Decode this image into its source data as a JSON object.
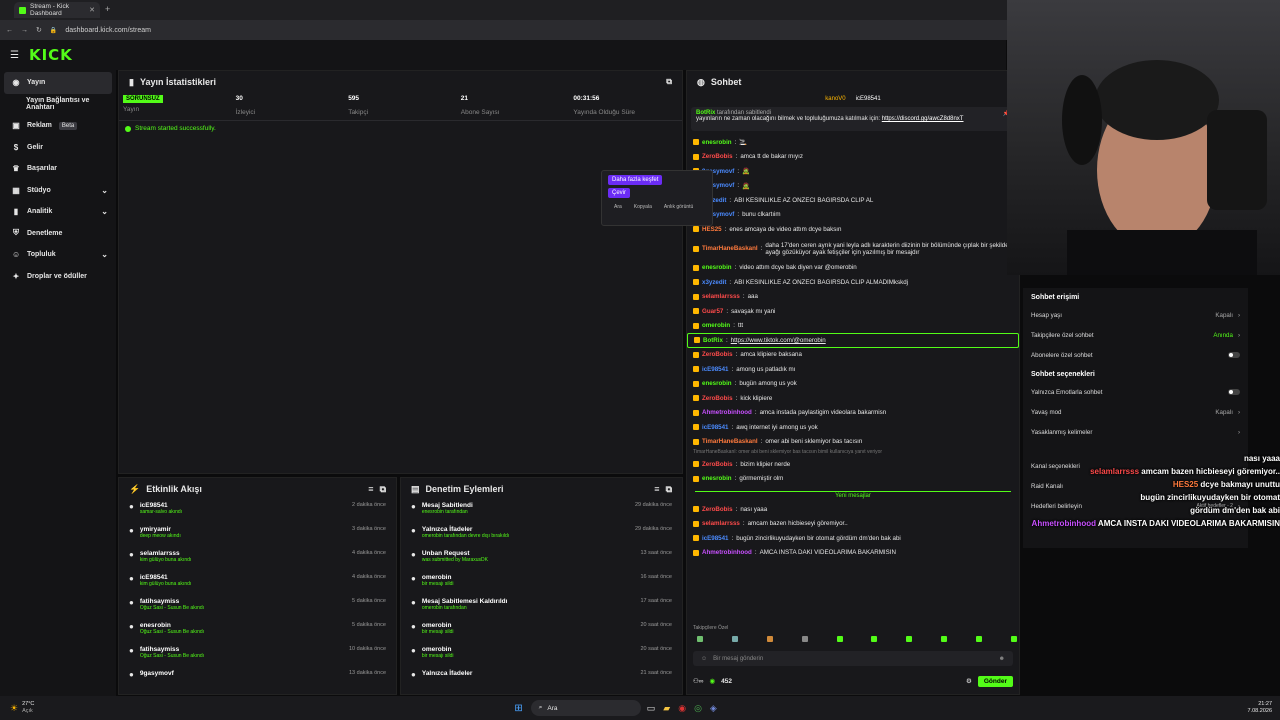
{
  "browser": {
    "tab_title": "Stream - Kick Dashboard",
    "url": "dashboard.kick.com/stream"
  },
  "brand": {
    "logo": "KICK",
    "accent": "#53fc18"
  },
  "sidebar": {
    "items": [
      {
        "label": "Yayın",
        "active": true
      },
      {
        "label": "Yayın Bağlantısı ve Anahtarı"
      },
      {
        "label": "Reklam",
        "badge": "Beta"
      },
      {
        "label": "Gelir"
      },
      {
        "label": "Başarılar"
      },
      {
        "label": "Stüdyo",
        "chevron": true
      },
      {
        "label": "Analitik",
        "chevron": true
      },
      {
        "label": "Denetleme"
      },
      {
        "label": "Topluluk",
        "chevron": true
      },
      {
        "label": "Droplar ve ödüller"
      }
    ]
  },
  "stats": {
    "title": "Yayın İstatistikleri",
    "live_badge": "SORUNSUZ",
    "items": [
      {
        "value": "",
        "label": "Yayın"
      },
      {
        "value": "30",
        "label": "İzleyici"
      },
      {
        "value": "595",
        "label": "Takipçi"
      },
      {
        "value": "21",
        "label": "Abone Sayısı"
      },
      {
        "value": "00:31:56",
        "label": "Yayında Olduğu Süre"
      }
    ],
    "success": "Stream started successfully."
  },
  "activity": {
    "title": "Etkinlik Akışı",
    "rows": [
      {
        "name": "icE98541",
        "sub": "samar-salvo akındı",
        "time": "2 dakika önce"
      },
      {
        "name": "ymiryamir",
        "sub": "deep meow akındı",
        "time": "3 dakika önce"
      },
      {
        "name": "selamlarrsss",
        "sub": "kim gülüyo buna akındı",
        "time": "4 dakika önce"
      },
      {
        "name": "icE98541",
        "sub": "kim gülüyo buna akındı",
        "time": "4 dakika önce"
      },
      {
        "name": "fatihsaymiss",
        "sub": "Oğuz Sasi - Susun Be akındı",
        "time": "5 dakika önce"
      },
      {
        "name": "enesrobin",
        "sub": "Oğuz Sasi - Susun Be akındı",
        "time": "5 dakika önce"
      },
      {
        "name": "fatihsaymiss",
        "sub": "Oğuz Sasi - Susun Be akındı",
        "time": "10 dakika önce"
      },
      {
        "name": "9gasymovf",
        "sub": "",
        "time": "13 dakika önce"
      }
    ]
  },
  "moderation": {
    "title": "Denetim Eylemleri",
    "rows": [
      {
        "name": "Mesaj Sabitlendi",
        "sub": "enesrobin tarafından",
        "time": "29 dakika önce"
      },
      {
        "name": "Yalnızca İfadeler",
        "sub": "omerobin tarafından devre dışı bırakıldı",
        "time": "29 dakika önce"
      },
      {
        "name": "Unban Request",
        "sub": "was submitted by MaraxusDK",
        "time": "13 saat önce"
      },
      {
        "name": "omerobin",
        "sub": "bir mesajı sildi",
        "time": "16 saat önce"
      },
      {
        "name": "Mesaj Sabitlemesi Kaldırıldı",
        "sub": "omerobin tarafından",
        "time": "17 saat önce"
      },
      {
        "name": "omerobin",
        "sub": "bir mesajı sildi",
        "time": "20 saat önce"
      },
      {
        "name": "omerobin",
        "sub": "bir mesajı sildi",
        "time": "20 saat önce"
      },
      {
        "name": "Yalnızca İfadeler",
        "sub": "",
        "time": "21 saat önce"
      }
    ]
  },
  "chat": {
    "title": "Sohbet",
    "top_users": [
      "kanoV0",
      "icE98541"
    ],
    "pinned_user": "BotRix",
    "pinned_by": "tarafından sabitlendi",
    "pinned_text": "yayınların ne zaman olacağını bilmek ve topluluğumuza katılmak için:",
    "pinned_link": "https://discord.gg/awcZ8d8nxT",
    "context": {
      "explore": "Daha fazla keşfet",
      "translate": "Çevir",
      "search": "Ara",
      "copy": "Kopyala",
      "view": "Anlık görüntü"
    },
    "messages": [
      {
        "user": "enesrobin",
        "color": "#53fc18",
        "text": "🚬"
      },
      {
        "user": "ZeroBobis",
        "color": "#ff4b4b",
        "text": "amca tt de bakar mıyız"
      },
      {
        "user": "9gasymovf",
        "color": "#4b8bff",
        "text": "🧟"
      },
      {
        "user": "9gasymovf",
        "color": "#4b8bff",
        "text": "🧟"
      },
      {
        "user": "x3yzedit",
        "color": "#4b8bff",
        "text": "ABI KESINLIKLE AZ ONZECI BAGIRSDA CLIP AL"
      },
      {
        "user": "9gasymovf",
        "color": "#4b8bff",
        "text": "bunu clkartıim"
      },
      {
        "user": "HES25",
        "color": "#ff7a3d",
        "text": "enes amcaya de video attım dcye baksın"
      },
      {
        "user": "TimarHaneBaskanI",
        "color": "#ff7a3d",
        "text": "daha 17'den ceren ayrık yani leyla adlı karakterin diizinin bir bölümünde çıplak bir şekilde ayağı gözüküyor ayak fetişçiler için yazılmış bir mesajdır"
      },
      {
        "user": "enesrobin",
        "color": "#53fc18",
        "text": "video attım dcye bak diyen var @omerobin"
      },
      {
        "user": "x3yzedit",
        "color": "#4b8bff",
        "text": "ABI KESINLIKLE AZ ONZECI BAGIRSDA CLIP ALMADIMkskdj"
      },
      {
        "user": "selamlarrsss",
        "color": "#ff4b4b",
        "text": "aaa"
      },
      {
        "user": "Guar57",
        "color": "#ff4b4b",
        "text": "savaşak mı yani"
      },
      {
        "user": "omerobin",
        "color": "#53fc18",
        "text": "ttt"
      },
      {
        "user": "BotRix",
        "color": "#53fc18",
        "text": "https://www.tiktok.com/@omerobin"
      },
      {
        "user": "ZeroBobis",
        "color": "#ff4b4b",
        "text": "amca klipiere baksana"
      },
      {
        "user": "icE98541",
        "color": "#4b8bff",
        "text": "among us patladık mı"
      },
      {
        "user": "enesrobin",
        "color": "#53fc18",
        "text": "bugün among us yok"
      },
      {
        "user": "ZeroBobis",
        "color": "#ff4b4b",
        "text": "kick klipiere"
      },
      {
        "user": "Ahmetrobinhood",
        "color": "#c850ff",
        "text": "amca instada paylastigim videolara bakarmisn"
      },
      {
        "user": "icE98541",
        "color": "#4b8bff",
        "text": "awq internet iyi among us yok"
      },
      {
        "user": "TimarHaneBaskanI",
        "color": "#ff7a3d",
        "text": "omer abi beni sklemiyor bas tacısın"
      },
      {
        "user": "ZeroBobis",
        "color": "#ff4b4b",
        "text": "bizim klipier nerde"
      },
      {
        "user": "enesrobin",
        "color": "#53fc18",
        "text": "görmemiştir olm"
      }
    ],
    "reply_preview": "TimarHaneBaskanI: omer abi beni sklemiyor bas tacısın bimil kullanıcıya yanıt veriyor",
    "new_label": "Yeni mesajlar",
    "new_messages": [
      {
        "user": "ZeroBobis",
        "color": "#ff4b4b",
        "text": "nası yaaa"
      },
      {
        "user": "selamlarrsss",
        "color": "#ff4b4b",
        "text": "amcam bazen hicbieseyi göremiyor.."
      },
      {
        "user": "icE98541",
        "color": "#4b8bff",
        "text": "bugün zincirlikuyudayken bir otomat gördüm dm'den bak abi"
      },
      {
        "user": "Ahmetrobinhood",
        "color": "#c850ff",
        "text": "AMCA INSTA DAKI VIDEOLARIMA BAKARMISIN"
      }
    ],
    "followers_only": "Takipçilere Özel",
    "input_placeholder": "Bir mesaj gönderin",
    "points": "452",
    "send": "Gönder"
  },
  "settings": {
    "access_title": "Sohbet erişimi",
    "access": [
      {
        "label": "Hesap yaşı",
        "value": "Kapalı"
      },
      {
        "label": "Takipçilere özel sohbet",
        "value": "Anında"
      },
      {
        "label": "Abonelere özel sohbet",
        "value": ""
      }
    ],
    "options_title": "Sohbet seçenekleri",
    "options": [
      {
        "label": "Yalnızca Emotlarla sohbet",
        "value": ""
      },
      {
        "label": "Yavaş mod",
        "value": "Kapalı"
      },
      {
        "label": "Yasaklanmış kelimeler",
        "value": ""
      },
      {
        "label": "Kanal seçenekleri",
        "value": ""
      },
      {
        "label": "Raid Kanalı",
        "value": ""
      },
      {
        "label": "Hedefleri belirleyin",
        "value": "Aktif hedefler - 2"
      }
    ]
  },
  "overlay": [
    {
      "user": "",
      "text": "nası yaaa"
    },
    {
      "user": "selamlarrsss",
      "text": "amcam bazen hicbieseyi göremiyor.."
    },
    {
      "user": "HES25",
      "text": "dcye bakmayı unuttu"
    },
    {
      "user": "",
      "text": "bugün zincirlikuyudayken bir otomat"
    },
    {
      "user": "",
      "text": "gördüm dm'den bak abi"
    },
    {
      "user": "Ahmetrobinhood",
      "text": "AMCA INSTA DAKI VIDEOLARIMA BAKARMISIN"
    }
  ],
  "taskbar": {
    "weather_temp": "27°C",
    "weather_desc": "Açık",
    "search": "Ara",
    "time": "21:27",
    "date": "7.08.2026"
  }
}
